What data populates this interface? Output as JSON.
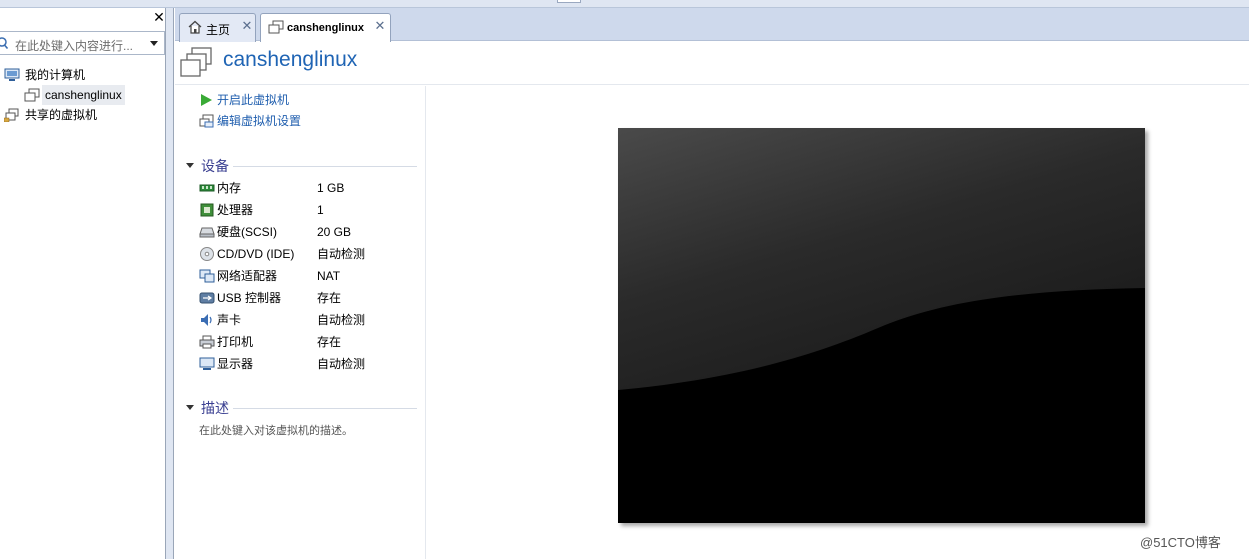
{
  "library": {
    "close_glyph": "✕",
    "search_placeholder": "在此处键入内容进行...",
    "tree": [
      {
        "label": "我的计算机",
        "icon": "computer-icon"
      },
      {
        "label": "canshenglinux",
        "icon": "vm-icon"
      },
      {
        "label": "共享的虚拟机",
        "icon": "shared-vm-icon"
      }
    ]
  },
  "tabs": [
    {
      "label": "主页",
      "icon": "home-icon",
      "close": "✕"
    },
    {
      "label": "canshenglinux",
      "icon": "vm-icon",
      "close": "✕"
    }
  ],
  "vm": {
    "title": "canshenglinux",
    "actions": [
      {
        "label": "开启此虚拟机",
        "icon": "play-icon"
      },
      {
        "label": "编辑虚拟机设置",
        "icon": "settings-icon"
      }
    ],
    "devices_section": "设备",
    "devices": [
      {
        "name": "内存",
        "value": "1 GB",
        "icon": "memory-icon"
      },
      {
        "name": "处理器",
        "value": "1",
        "icon": "cpu-icon"
      },
      {
        "name": "硬盘(SCSI)",
        "value": "20 GB",
        "icon": "hard-disk-icon"
      },
      {
        "name": "CD/DVD (IDE)",
        "value": "自动检测",
        "icon": "cd-dvd-icon"
      },
      {
        "name": "网络适配器",
        "value": "NAT",
        "icon": "network-adapter-icon"
      },
      {
        "name": "USB 控制器",
        "value": "存在",
        "icon": "usb-icon"
      },
      {
        "name": "声卡",
        "value": "自动检测",
        "icon": "sound-card-icon"
      },
      {
        "name": "打印机",
        "value": "存在",
        "icon": "printer-icon"
      },
      {
        "name": "显示器",
        "value": "自动检测",
        "icon": "display-icon"
      }
    ],
    "description_section": "描述",
    "description_placeholder": "在此处键入对该虚拟机的描述。"
  },
  "watermark": "@51CTO博客",
  "colors": {
    "title_blue": "#1f64b4",
    "link_blue": "#1f5eae",
    "section_purple": "#3a3f91",
    "tab_strip": "#ced9ec"
  }
}
